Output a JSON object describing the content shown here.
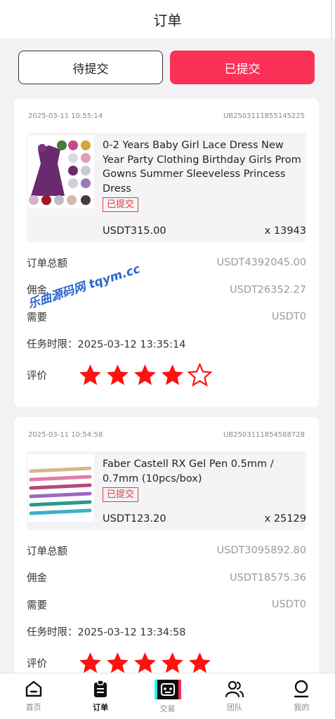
{
  "header": {
    "title": "订单"
  },
  "tabs": [
    {
      "label": "待提交",
      "active": false
    },
    {
      "label": "已提交",
      "active": true
    }
  ],
  "orders": [
    {
      "datetime": "2025-03-11 10:55:14",
      "order_no": "UB2503111855145225",
      "product_name": "0-2 Years Baby Girl Lace Dress New Year Party Clothing Birthday Girls Prom Gowns Summer Sleeveless Princess Dress",
      "status_badge": "已提交",
      "price": "USDT315.00",
      "quantity": "x 13943",
      "total_label": "订单总额",
      "total_value": "USDT4392045.00",
      "commission_label": "佣金",
      "commission_value": "USDT26352.27",
      "need_label": "需要",
      "need_value": "USDT0",
      "deadline": "任务时限：2025-03-12 13:35:14",
      "rating_label": "评价",
      "rating": 4
    },
    {
      "datetime": "2025-03-11 10:54:58",
      "order_no": "UB2503111854588728",
      "product_name": "Faber Castell RX Gel Pen 0.5mm / 0.7mm (10pcs/box)",
      "status_badge": "已提交",
      "price": "USDT123.20",
      "quantity": "x 25129",
      "total_label": "订单总额",
      "total_value": "USDT3095892.80",
      "commission_label": "佣金",
      "commission_value": "USDT18575.36",
      "need_label": "需要",
      "need_value": "USDT0",
      "deadline": "任务时限：2025-03-12 13:34:58",
      "rating_label": "评价",
      "rating": 5
    }
  ],
  "watermark": "乐曲源码网 tqym.cc",
  "nav": [
    {
      "label": "首页",
      "icon": "home-icon",
      "active": false
    },
    {
      "label": "订单",
      "icon": "clipboard-icon",
      "active": true
    },
    {
      "label": "交易",
      "icon": "trade-icon",
      "active": false
    },
    {
      "label": "团队",
      "icon": "team-icon",
      "active": false
    },
    {
      "label": "我的",
      "icon": "profile-icon",
      "active": false
    }
  ],
  "colors": {
    "accent": "#fb3157",
    "star": "#ff1111",
    "badge": "#e63946"
  }
}
